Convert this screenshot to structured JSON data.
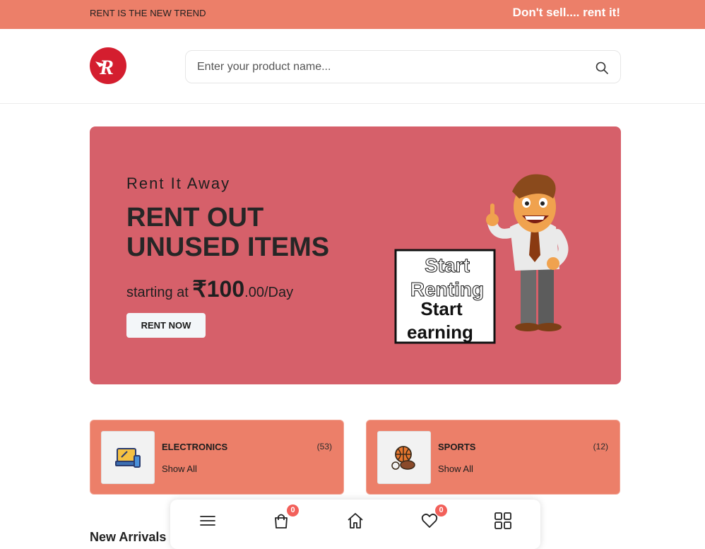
{
  "topbar": {
    "tagline": "RENT IS THE NEW TREND",
    "slogan": "Don't sell.... rent it!"
  },
  "header": {
    "logo_letter": "R",
    "search": {
      "placeholder": "Enter your product name..."
    }
  },
  "hero": {
    "subtitle": "Rent It Away",
    "title_line1": "RENT OUT",
    "title_line2": "UNUSED ITEMS",
    "price_prefix": "starting at ",
    "price_currency": "₹",
    "price_amount": "100",
    "price_suffix": ".00/Day",
    "cta_label": "RENT NOW",
    "art_text": [
      "Start",
      "Renting",
      "Start",
      "earning"
    ]
  },
  "categories": [
    {
      "name": "ELECTRONICS",
      "count": "(53)",
      "link": "Show All",
      "icon": "electronics-icon"
    },
    {
      "name": "SPORTS",
      "count": "(12)",
      "link": "Show All",
      "icon": "sports-ball-icon"
    }
  ],
  "section_title": "New Arrivals",
  "bottom_nav": {
    "cart_count": "0",
    "wishlist_count": "0"
  },
  "colors": {
    "topbar": "#ec7f69",
    "hero": "#d6606a",
    "brand_red": "#d41e2f",
    "badge": "#f2605a"
  }
}
